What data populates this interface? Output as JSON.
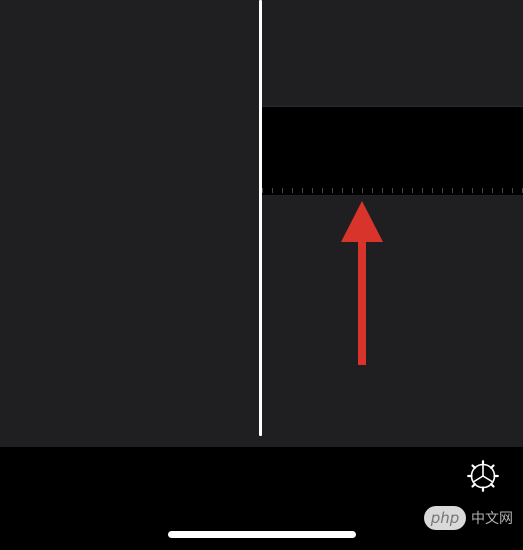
{
  "colors": {
    "editor_background": "#1f1f21",
    "track_background": "#000000",
    "playhead": "#ffffff",
    "annotation_arrow": "#d9342b",
    "bottom_bar": "#000000"
  },
  "icons": {
    "settings": "gear-icon"
  },
  "watermark": {
    "logo_text": "php",
    "site_text": "中文网"
  }
}
